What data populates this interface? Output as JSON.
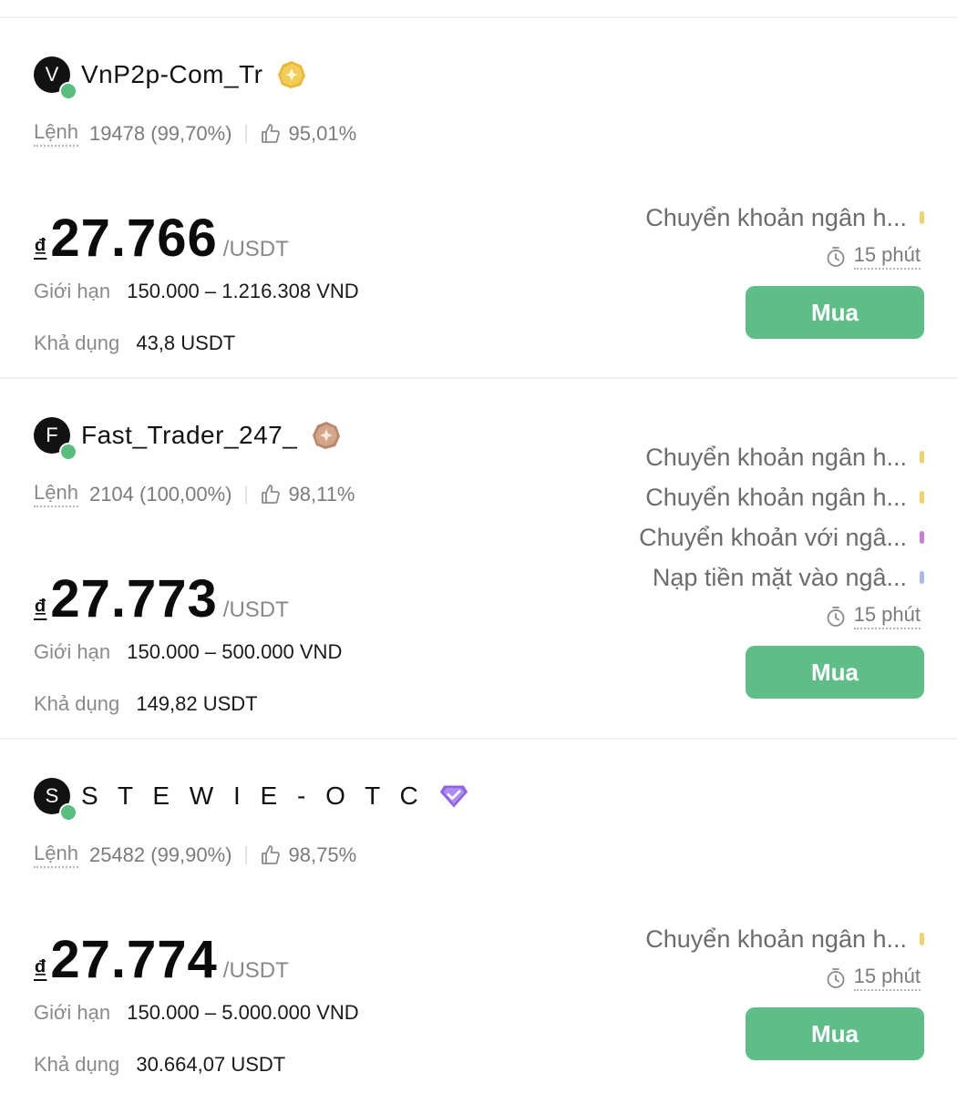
{
  "offers": [
    {
      "avatar_letter": "V",
      "name": "VnP2p-Com_Tr",
      "badge": "gold-merchant-icon",
      "orders_label": "Lệnh",
      "orders": "19478 (99,70%)",
      "rating": "95,01%",
      "currency_symbol": "₫",
      "price": "27.766",
      "unit": "/USDT",
      "limit_label": "Giới hạn",
      "limit": "150.000 – 1.216.308 VND",
      "available_label": "Khả dụng",
      "available": "43,8 USDT",
      "payments": [
        {
          "label": "Chuyển khoản ngân h...",
          "color": "#f0d26a"
        }
      ],
      "time": "15 phút",
      "buy_label": "Mua"
    },
    {
      "avatar_letter": "F",
      "name": "Fast_Trader_247_",
      "badge": "bronze-merchant-icon",
      "orders_label": "Lệnh",
      "orders": "2104 (100,00%)",
      "rating": "98,11%",
      "currency_symbol": "₫",
      "price": "27.773",
      "unit": "/USDT",
      "limit_label": "Giới hạn",
      "limit": "150.000 – 500.000 VND",
      "available_label": "Khả dụng",
      "available": "149,82 USDT",
      "payments": [
        {
          "label": "Chuyển khoản ngân h...",
          "color": "#f0d26a"
        },
        {
          "label": "Chuyển khoản ngân h...",
          "color": "#f0d26a"
        },
        {
          "label": "Chuyển khoản với ngâ...",
          "color": "#c77fd6"
        },
        {
          "label": "Nạp tiền mặt vào ngâ...",
          "color": "#a9b6e8"
        }
      ],
      "time": "15 phút",
      "buy_label": "Mua"
    },
    {
      "avatar_letter": "S",
      "name": "S T E W I E - O T C",
      "badge": "diamond-merchant-icon",
      "orders_label": "Lệnh",
      "orders": "25482 (99,90%)",
      "rating": "98,75%",
      "currency_symbol": "₫",
      "price": "27.774",
      "unit": "/USDT",
      "limit_label": "Giới hạn",
      "limit": "150.000 – 5.000.000 VND",
      "available_label": "Khả dụng",
      "available": "30.664,07 USDT",
      "payments": [
        {
          "label": "Chuyển khoản ngân h...",
          "color": "#f0d26a"
        }
      ],
      "time": "15 phút",
      "buy_label": "Mua"
    }
  ]
}
